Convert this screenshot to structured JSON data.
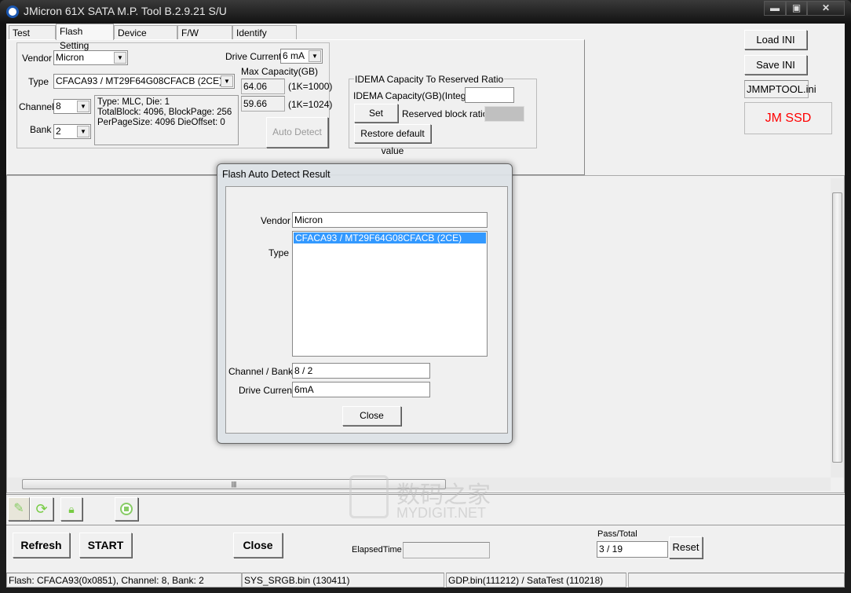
{
  "window": {
    "title": "JMicron 61X SATA M.P. Tool B.2.9.21 S/U",
    "minimize": "▬",
    "maximize": "▣",
    "close": "✕"
  },
  "tabs": [
    {
      "label": "Test Items"
    },
    {
      "label": "Flash Setting"
    },
    {
      "label": "Device Setting"
    },
    {
      "label": "F/W Setting"
    },
    {
      "label": "Identify Setting"
    }
  ],
  "flash": {
    "vendor_label": "Vendor",
    "vendor": "Micron",
    "type_label": "Type",
    "type": "CFACA93  /  MT29F64G08CFACB (2CE)",
    "channel_label": "Channel",
    "channel": "8",
    "bank_label": "Bank",
    "bank": "2",
    "info": [
      "Type: MLC, Die: 1",
      "TotalBlock: 4096, BlockPage: 256",
      "PerPageSize: 4096 DieOffset: 0"
    ],
    "drive_current_label": "Drive Current",
    "drive_current": "6 mA",
    "max_cap_label": "Max Capacity(GB)",
    "cap1000": "64.06",
    "cap1000_unit": "(1K=1000)",
    "cap1024": "59.66",
    "cap1024_unit": "(1K=1024)",
    "auto_detect": "Auto Detect"
  },
  "idema": {
    "title": "IDEMA Capacity To Reserved Ratio",
    "cap_label": "IDEMA Capacity(GB)(Integer)",
    "cap_value": "",
    "set": "Set",
    "ratio_label": "Reserved block ratio",
    "restore": "Restore default value"
  },
  "right": {
    "load_ini": "Load INI",
    "save_ini": "Save INI",
    "ini_file": "JMMPTOOL.ini",
    "brand": "JM SSD",
    "brand_color": "#ff0000"
  },
  "dialog": {
    "title": "Flash Auto Detect Result",
    "vendor_label": "Vendor",
    "vendor": "Micron",
    "type_label": "Type",
    "types": [
      "CFACA93  /  MT29F64G08CFACB (2CE)"
    ],
    "selected_color": "#3399ff",
    "chbank_label": "Channel / Bank",
    "chbank": "8 / 2",
    "drive_label": "Drive Current",
    "drive": "6mA",
    "close": "Close"
  },
  "toolbar": {
    "icons": [
      "pin-icon",
      "refresh-icon",
      "lock-icon",
      "stop-icon"
    ]
  },
  "controls": {
    "refresh": "Refresh",
    "start": "START",
    "close": "Close",
    "elapsed_label": "ElapsedTime",
    "elapsed": "",
    "pass_total_label": "Pass/Total",
    "pass_total": "3 / 19",
    "reset": "Reset"
  },
  "status": [
    "Flash: CFACA93(0x0851), Channel: 8, Bank: 2",
    "SYS_SRGB.bin (130411)",
    "GDP.bin(111212) / SataTest (110218)",
    ""
  ],
  "watermark": {
    "cn": "数码之家",
    "en": "MYDIGIT.NET"
  }
}
